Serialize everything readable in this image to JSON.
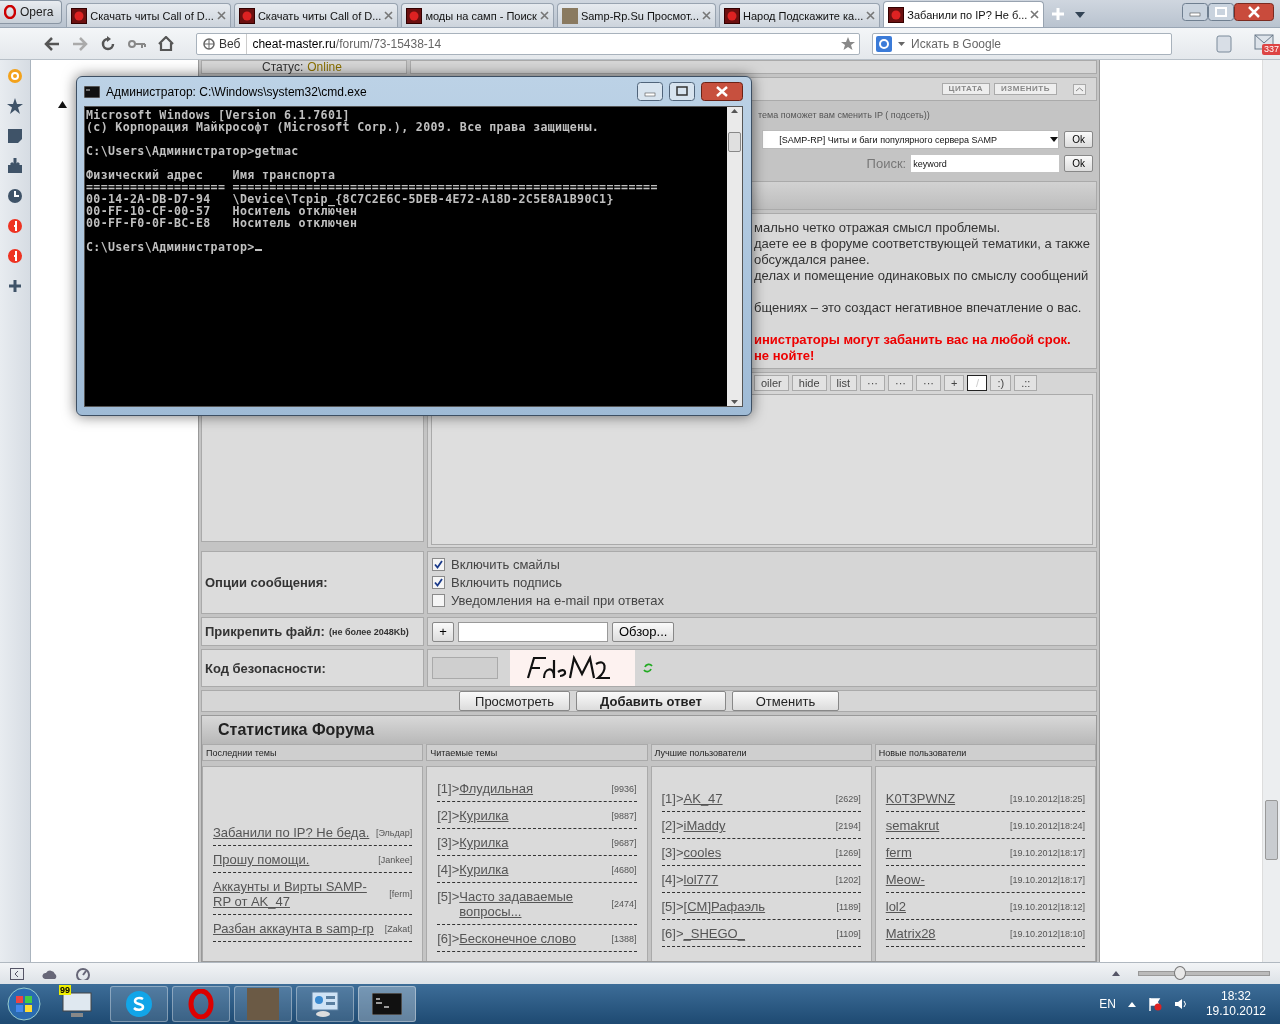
{
  "browser": {
    "menu_button": "Opera",
    "tabs": [
      {
        "title": "Скачать читы Call of D...",
        "selected": false,
        "kind": "site"
      },
      {
        "title": "Скачать читы Call of D...",
        "selected": false,
        "kind": "site"
      },
      {
        "title": "моды на самп - Поиск",
        "selected": false,
        "kind": "site"
      },
      {
        "title": "Samp-Rp.Su Просмот...",
        "selected": false,
        "kind": "avatar"
      },
      {
        "title": "Народ Подскажите ка...",
        "selected": false,
        "kind": "site"
      },
      {
        "title": "Забанили по IP? Не б...",
        "selected": true,
        "kind": "site"
      }
    ],
    "address": {
      "badge": "Веб",
      "host": "cheat-master.ru",
      "path": "/forum/73-15438-14"
    },
    "search_placeholder": "Искать в Google",
    "mail_count": "337"
  },
  "forum": {
    "status": {
      "label": "Статус:",
      "value": "Online"
    },
    "post_buttons": [
      "ЦИТАТА",
      "ИЗМЕНИТЬ"
    ],
    "hint": "тема поможет вам сменить IP ( подсеть))",
    "forum_select": {
      "value": "[SAMP-RP] Читы и баги популярного сервера SAMP",
      "button": "Ok"
    },
    "search": {
      "label": "Поиск:",
      "value": "keyword",
      "button": "Ok"
    },
    "rules": [
      {
        "kind": "normal",
        "lines": [
          "мально четко отражая смысл проблемы.",
          "даете ее в форуме соответствующей тематики, а также",
          "обсуждался ранее.",
          "делах и помещение одинаковых по смыслу сообщений"
        ]
      },
      {
        "kind": "normal",
        "lines": [
          "бщениях – это создаст негативное впечатление о вас."
        ]
      },
      {
        "kind": "warning",
        "lines": [
          "инистраторы могут забанить вас на любой срок.",
          "не нойте!"
        ]
      }
    ],
    "editor_buttons": [
      {
        "label": "oiler",
        "kind": "text"
      },
      {
        "label": "hide",
        "kind": "text"
      },
      {
        "label": "list",
        "kind": "text"
      },
      {
        "label": "···",
        "kind": "text"
      },
      {
        "label": "···",
        "kind": "text"
      },
      {
        "label": "···",
        "kind": "text"
      },
      {
        "label": "+",
        "kind": "text"
      },
      {
        "label": "/",
        "kind": "swatch"
      },
      {
        "label": ":)",
        "kind": "text"
      },
      {
        "label": ".::",
        "kind": "text"
      }
    ],
    "options": {
      "label": "Опции сообщения:",
      "items": [
        {
          "label": "Включить смайлы",
          "checked": true
        },
        {
          "label": "Включить подпись",
          "checked": true
        },
        {
          "label": "Уведомления на e-mail при ответах",
          "checked": false
        }
      ]
    },
    "attach": {
      "label": "Прикрепить файл:",
      "note": "(не более 2048Kb)",
      "add_button": "+",
      "browse_button": "Обзор..."
    },
    "captcha": {
      "label": "Код безопасности:"
    },
    "actions": [
      {
        "label": "Просмотреть",
        "primary": false
      },
      {
        "label": "Добавить ответ",
        "primary": true
      },
      {
        "label": "Отменить",
        "primary": false
      }
    ]
  },
  "stats": {
    "title": "Статистика Форума",
    "columns": [
      {
        "heading": "Последнии темы",
        "items": [
          {
            "link": "Забанили по IP? Не беда.",
            "meta": "[Эльдар]"
          },
          {
            "link": "Прошу помощи.",
            "meta": "[Jankee]"
          },
          {
            "link": "Аккаунты и Вирты SAMP-RP от AK_47",
            "meta": "[ferm]"
          },
          {
            "link": "Разбан аккаунта в samp-rp",
            "meta": "[Zakat]"
          }
        ]
      },
      {
        "heading": "Читаемые темы",
        "items": [
          {
            "prefix": "[1]>",
            "link": "Флудильная",
            "meta": "[9936]"
          },
          {
            "prefix": "[2]>",
            "link": "Курилка",
            "meta": "[9887]"
          },
          {
            "prefix": "[3]>",
            "link": "Курилка",
            "meta": "[9687]"
          },
          {
            "prefix": "[4]>",
            "link": "Курилка",
            "meta": "[4680]"
          },
          {
            "prefix": "[5]>",
            "link": "Часто задаваемые вопросы...",
            "meta": "[2474]"
          },
          {
            "prefix": "[6]>",
            "link": "Бесконечное слово",
            "meta": "[1388]"
          }
        ]
      },
      {
        "heading": "Лучшие пользователи",
        "items": [
          {
            "prefix": "[1]>",
            "link": "AK_47",
            "meta": "[2629]"
          },
          {
            "prefix": "[2]>",
            "link": "iMaddy",
            "meta": "[2194]"
          },
          {
            "prefix": "[3]>",
            "link": "cooles",
            "meta": "[1269]"
          },
          {
            "prefix": "[4]>",
            "link": "lol777",
            "meta": "[1202]"
          },
          {
            "prefix": "[5]>",
            "link": "[CM]Рафаэль",
            "meta": "[1189]"
          },
          {
            "prefix": "[6]>",
            "link": "_SHEGO_",
            "meta": "[1109]"
          }
        ]
      },
      {
        "heading": "Новые пользователи",
        "items": [
          {
            "link": "K0T3PWNZ",
            "meta": "[19.10.2012|18:25]"
          },
          {
            "link": "semakrut",
            "meta": "[19.10.2012|18:24]"
          },
          {
            "link": "ferm",
            "meta": "[19.10.2012|18:17]"
          },
          {
            "link": "Meow-",
            "meta": "[19.10.2012|18:17]"
          },
          {
            "link": "lol2",
            "meta": "[19.10.2012|18:12]"
          },
          {
            "link": "Matrix28",
            "meta": "[19.10.2012|18:10]"
          }
        ]
      }
    ]
  },
  "cmd": {
    "title": "Администратор: C:\\Windows\\system32\\cmd.exe",
    "blocks": [
      [
        "Microsoft Windows [Version 6.1.7601]",
        "(c) Корпорация Майкрософт (Microsoft Corp.), 2009. Все права защищены."
      ],
      [
        "C:\\Users\\Администратор>getmac"
      ],
      [
        "Физический адрес    Имя транспорта",
        "=================== ==========================================================",
        "00-14-2A-DB-D7-94   \\Device\\Tcpip_{8C7C2E6C-5DEB-4E72-A18D-2C5E8A1B90C1}",
        "00-FF-10-CF-00-57   Носитель отключен",
        "00-FF-F0-0F-BC-E8   Носитель отключен"
      ],
      [
        "C:\\Users\\Администратор>"
      ]
    ]
  },
  "status_bar": {
    "zoom": {
      "level": 0.31
    }
  },
  "taskbar": {
    "badge": "99",
    "language": "EN",
    "time": "18:32",
    "date": "19.10.2012"
  }
}
